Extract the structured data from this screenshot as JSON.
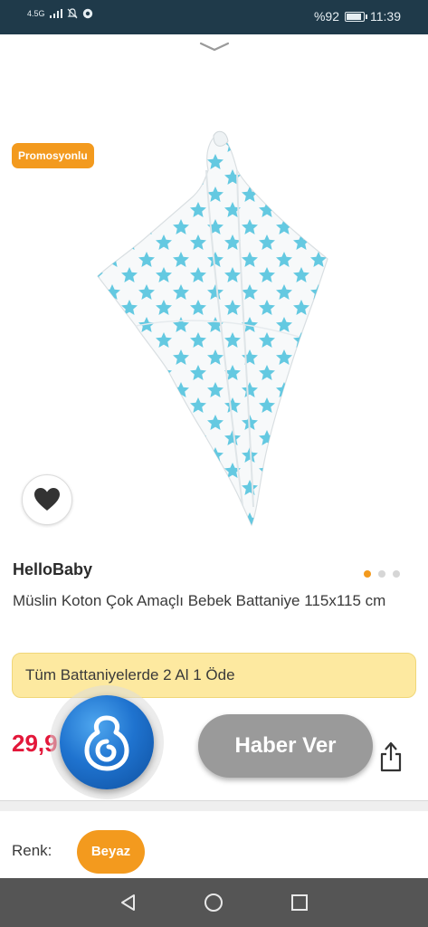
{
  "status_bar": {
    "network": "4.5G",
    "battery_text": "%92",
    "battery_level": 0.92,
    "time": "11:39"
  },
  "product": {
    "promo_badge": "Promosyonlu",
    "brand": "HelloBaby",
    "title": "Müslin Koton Çok Amaçlı Bebek Battaniye 115x115 cm",
    "campaign": "Tüm Battaniyelerde 2 Al 1 Öde",
    "price": "29,9",
    "image_count": 3,
    "active_image_index": 0
  },
  "actions": {
    "notify_label": "Haber Ver"
  },
  "variant": {
    "color_label": "Renk:",
    "color_value": "Beyaz"
  },
  "colors": {
    "accent": "#f39a1e",
    "price": "#e3173a",
    "status_bar": "#1f3a4a",
    "star": "#5cc6e0"
  },
  "icons": {
    "pull": "chevron-down-icon",
    "favorite": "heart-icon",
    "share": "share-icon",
    "assistant": "assistant-logo-icon",
    "nav_back": "back-triangle-icon",
    "nav_home": "home-circle-icon",
    "nav_recent": "recent-square-icon"
  }
}
